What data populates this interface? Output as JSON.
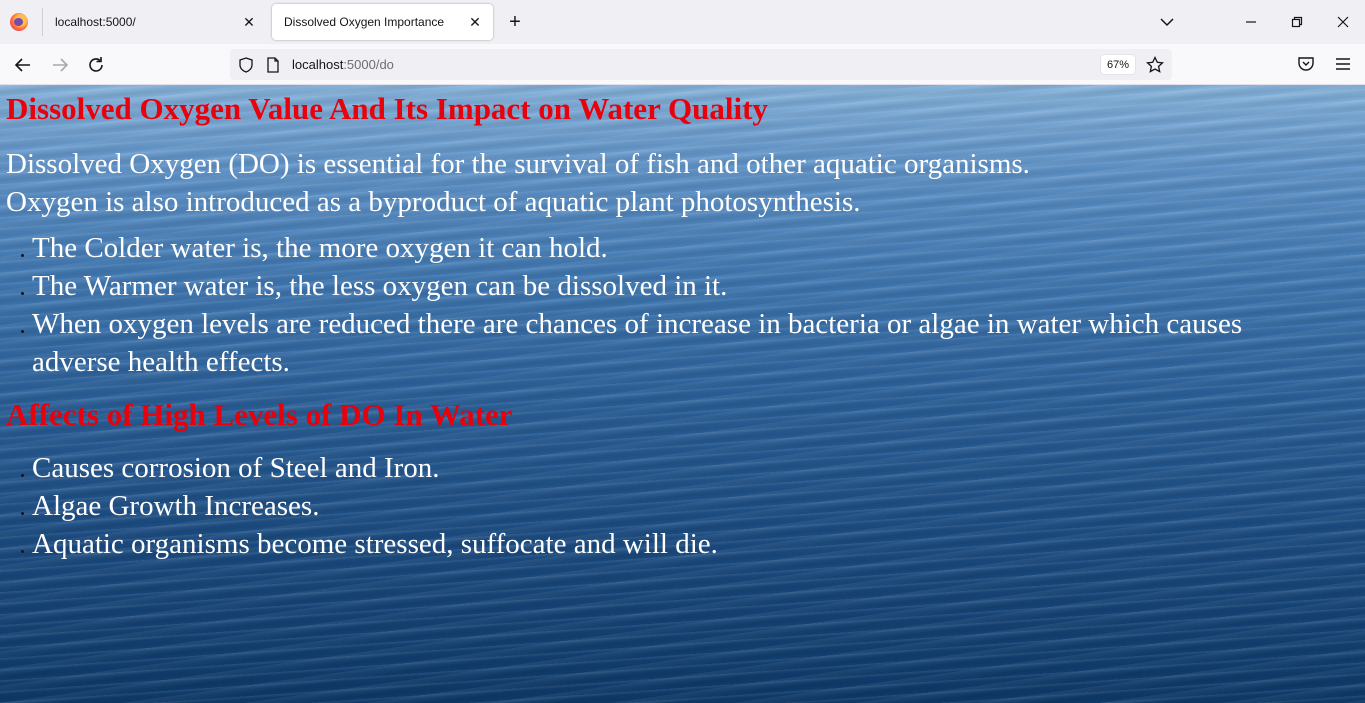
{
  "browser": {
    "tabs": [
      {
        "title": "localhost:5000/",
        "active": false
      },
      {
        "title": "Dissolved Oxygen Importance",
        "active": true
      }
    ],
    "url": {
      "host": "localhost",
      "path": ":5000/do"
    },
    "zoom": "67%"
  },
  "page": {
    "heading1": "Dissolved Oxygen Value And Its Impact on Water Quality",
    "intro_line1": "Dissolved Oxygen (DO) is essential for the survival of fish and other aquatic organisms.",
    "intro_line2": "Oxygen is also introduced as a byproduct of aquatic plant photosynthesis.",
    "facts": [
      "The Colder water is, the more oxygen it can hold.",
      "The Warmer water is, the less oxygen can be dissolved in it.",
      "When oxygen levels are reduced there are chances of increase in bacteria or algae in water which causes adverse health effects."
    ],
    "heading2": "Affects of High Levels of DO In Water",
    "high_do_effects": [
      "Causes corrosion of Steel and Iron.",
      "Algae Growth Increases.",
      "Aquatic organisms become stressed, suffocate and will die."
    ]
  },
  "colors": {
    "heading_red": "#e8000b",
    "body_text": "#ffffff",
    "water_top": "#86b3dc",
    "water_bottom": "#0e3a6a"
  },
  "icons": [
    "firefox-logo-icon",
    "close-icon",
    "plus-icon",
    "chevron-down-icon",
    "minimize-icon",
    "restore-icon",
    "back-arrow-icon",
    "forward-arrow-icon",
    "reload-icon",
    "shield-icon",
    "page-icon",
    "star-icon",
    "pocket-icon",
    "hamburger-menu-icon"
  ]
}
